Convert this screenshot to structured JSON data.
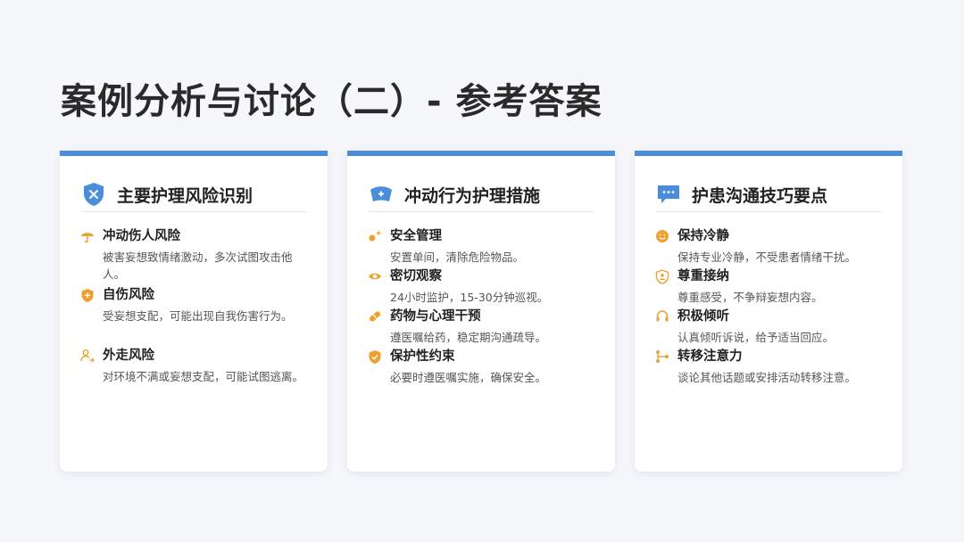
{
  "page": {
    "title": "案例分析与讨论（二）- 参考答案"
  },
  "colors": {
    "accent": "#4a8edb",
    "icon_orange": "#f0a030"
  },
  "cards": [
    {
      "title": "主要护理风险识别",
      "icon": "shield-x-icon",
      "items": [
        {
          "icon": "umbrella-icon",
          "title": "冲动伤人风险",
          "desc": "被害妄想致情绪激动，多次试图攻击他人。"
        },
        {
          "icon": "shield-plus-icon",
          "title": "自伤风险",
          "desc": "受妄想支配，可能出现自我伤害行为。"
        },
        {
          "icon": "person-leave-icon",
          "title": "外走风险",
          "desc": "对环境不满或妄想支配，可能试图逃离。"
        }
      ]
    },
    {
      "title": "冲动行为护理措施",
      "icon": "medical-cap-icon",
      "items": [
        {
          "icon": "spark-tools-icon",
          "title": "安全管理",
          "desc": "安置单间，清除危险物品。"
        },
        {
          "icon": "eye-icon",
          "title": "密切观察",
          "desc": "24小时监护，15-30分钟巡视。"
        },
        {
          "icon": "pill-icon",
          "title": "药物与心理干预",
          "desc": "遵医嘱给药，稳定期沟通疏导。"
        },
        {
          "icon": "shield-check-icon",
          "title": "保护性约束",
          "desc": "必要时遵医嘱实施，确保安全。"
        }
      ]
    },
    {
      "title": "护患沟通技巧要点",
      "icon": "chat-bubble-icon",
      "items": [
        {
          "icon": "smile-icon",
          "title": "保持冷静",
          "desc": "保持专业冷静，不受患者情绪干扰。"
        },
        {
          "icon": "user-shield-icon",
          "title": "尊重接纳",
          "desc": "尊重感受，不争辩妄想内容。"
        },
        {
          "icon": "headset-icon",
          "title": "积极倾听",
          "desc": "认真倾听诉说，给予适当回应。"
        },
        {
          "icon": "route-icon",
          "title": "转移注意力",
          "desc": "谈论其他话题或安排活动转移注意。"
        }
      ]
    }
  ]
}
